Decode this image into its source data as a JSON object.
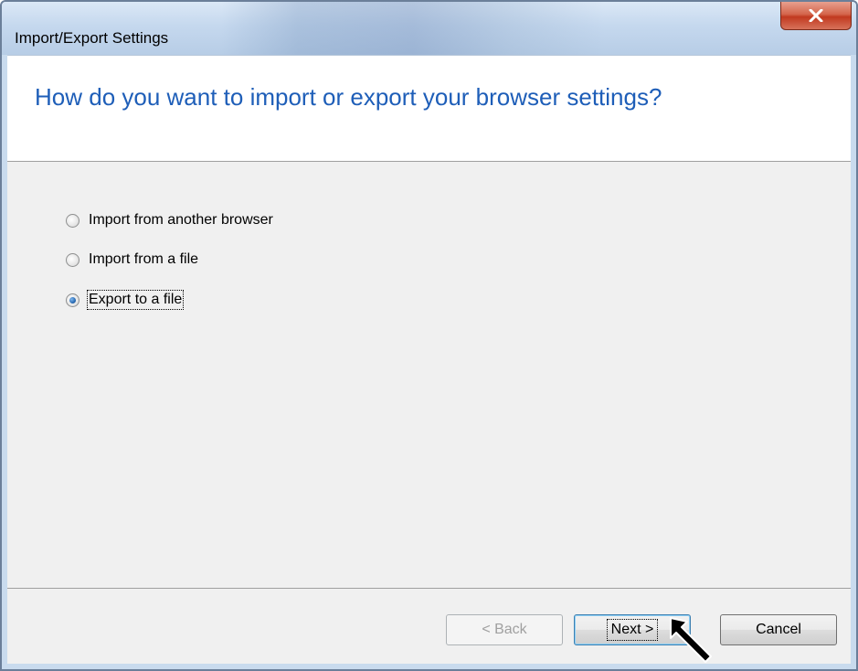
{
  "window": {
    "title": "Import/Export Settings",
    "close_icon": "close-icon"
  },
  "header": {
    "heading": "How do you want to import or export your browser settings?"
  },
  "options": [
    {
      "label": "Import from another browser",
      "checked": false
    },
    {
      "label": "Import from a file",
      "checked": false
    },
    {
      "label": "Export to a file",
      "checked": true
    }
  ],
  "buttons": {
    "back": "< Back",
    "next": "Next >",
    "cancel": "Cancel"
  },
  "colors": {
    "heading": "#1e5eb8",
    "close_button": "#c1391f"
  }
}
